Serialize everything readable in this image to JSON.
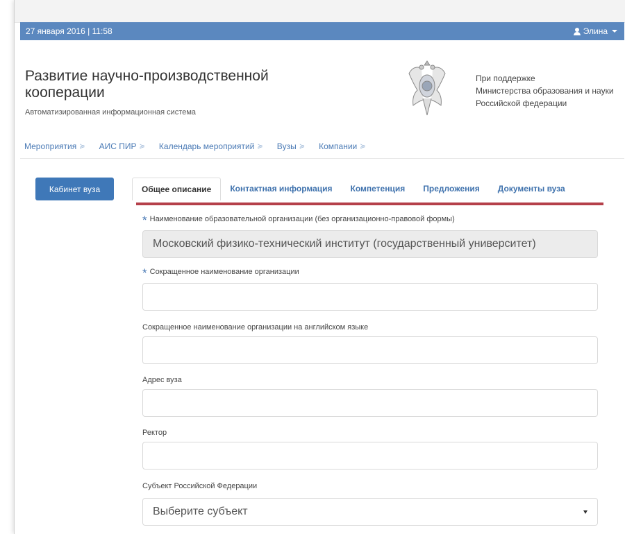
{
  "topbar": {
    "datetime": "27 января 2016 | 11:58",
    "user_name": "Элина"
  },
  "header": {
    "title": "Развитие научно-производственной кооперации",
    "subtitle": "Автоматизированная информационная система",
    "support_lines": [
      "При поддержке",
      "Министерства образования и науки",
      "Российской федерации"
    ]
  },
  "nav": {
    "items": [
      {
        "label": "Мероприятия"
      },
      {
        "label": "АИС ПИР"
      },
      {
        "label": "Календарь мероприятий"
      },
      {
        "label": "Вузы"
      },
      {
        "label": "Компании"
      }
    ]
  },
  "sidebar": {
    "cabinet_button": "Кабинет вуза"
  },
  "tabs": [
    {
      "label": "Общее описание",
      "active": true
    },
    {
      "label": "Контактная информация",
      "active": false
    },
    {
      "label": "Компетенция",
      "active": false
    },
    {
      "label": "Предложения",
      "active": false
    },
    {
      "label": "Документы вуза",
      "active": false
    }
  ],
  "form": {
    "required_mark": "*",
    "org_name_label": "Наименование образовательной организации (без организационно-правовой формы)",
    "org_name_value": "Московский физико-технический институт (государственный университет)",
    "short_name_label": "Сокращенное наименование организации",
    "short_name_value": "",
    "short_name_en_label": "Сокращенное наименование организации на английском языке",
    "short_name_en_value": "",
    "address_label": "Адрес вуза",
    "address_value": "",
    "rector_label": "Ректор",
    "rector_value": "",
    "region_label": "Субъект Российской Федерации",
    "region_placeholder": "Выберите субъект"
  },
  "colors": {
    "topbar": "#5b88bf",
    "link": "#3f72ad",
    "button": "#3f78b8",
    "tab_underline": "#b5404a"
  }
}
